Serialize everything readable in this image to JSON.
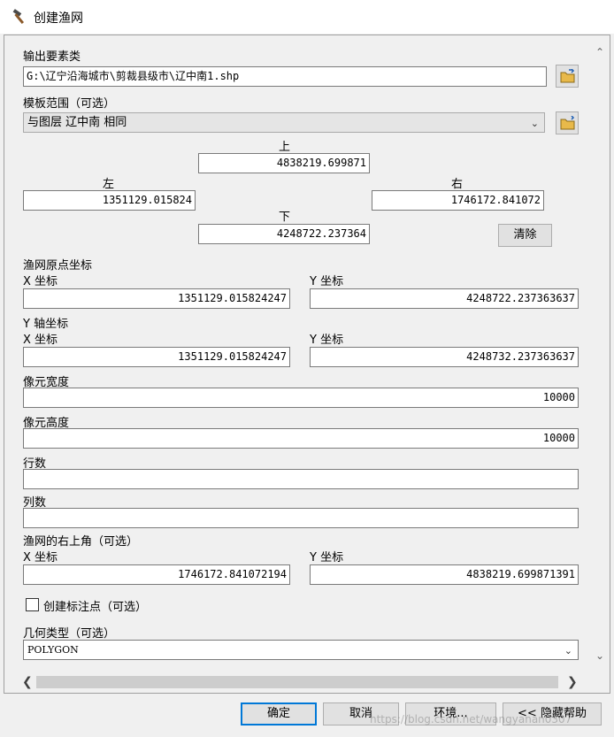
{
  "window": {
    "title": "创建渔网",
    "icon": "hammer-icon"
  },
  "form": {
    "output_label": "输出要素类",
    "output_value": "G:\\辽宁沿海城市\\剪裁县级市\\辽中南1.shp",
    "template_label": "模板范围（可选）",
    "template_value": "与图层 辽中南 相同",
    "extent": {
      "top_label": "上",
      "top_value": "4838219.699871",
      "left_label": "左",
      "left_value": "1351129.015824",
      "right_label": "右",
      "right_value": "1746172.841072",
      "bottom_label": "下",
      "bottom_value": "4248722.237364",
      "clear_label": "清除"
    },
    "origin": {
      "label": "渔网原点坐标",
      "x_label": "X 坐标",
      "x_value": "1351129.015824247",
      "y_label": "Y 坐标",
      "y_value": "4248722.237363637"
    },
    "yaxis": {
      "label": "Y 轴坐标",
      "x_label": "X 坐标",
      "x_value": "1351129.015824247",
      "y_label": "Y 坐标",
      "y_value": "4248732.237363637"
    },
    "cell_width_label": "像元宽度",
    "cell_width_value": "10000",
    "cell_height_label": "像元高度",
    "cell_height_value": "10000",
    "rows_label": "行数",
    "rows_value": "",
    "cols_label": "列数",
    "cols_value": "",
    "corner": {
      "label": "渔网的右上角（可选）",
      "x_label": "X 坐标",
      "x_value": "1746172.841072194",
      "y_label": "Y 坐标",
      "y_value": "4838219.699871391"
    },
    "labels_checkbox": "创建标注点（可选）",
    "geometry_label": "几何类型（可选）",
    "geometry_value": "POLYGON"
  },
  "buttons": {
    "ok": "确定",
    "cancel": "取消",
    "env": "环境...",
    "help": "<< 隐藏帮助"
  },
  "watermark": "https://blog.csdn.net/wangyanan0307"
}
